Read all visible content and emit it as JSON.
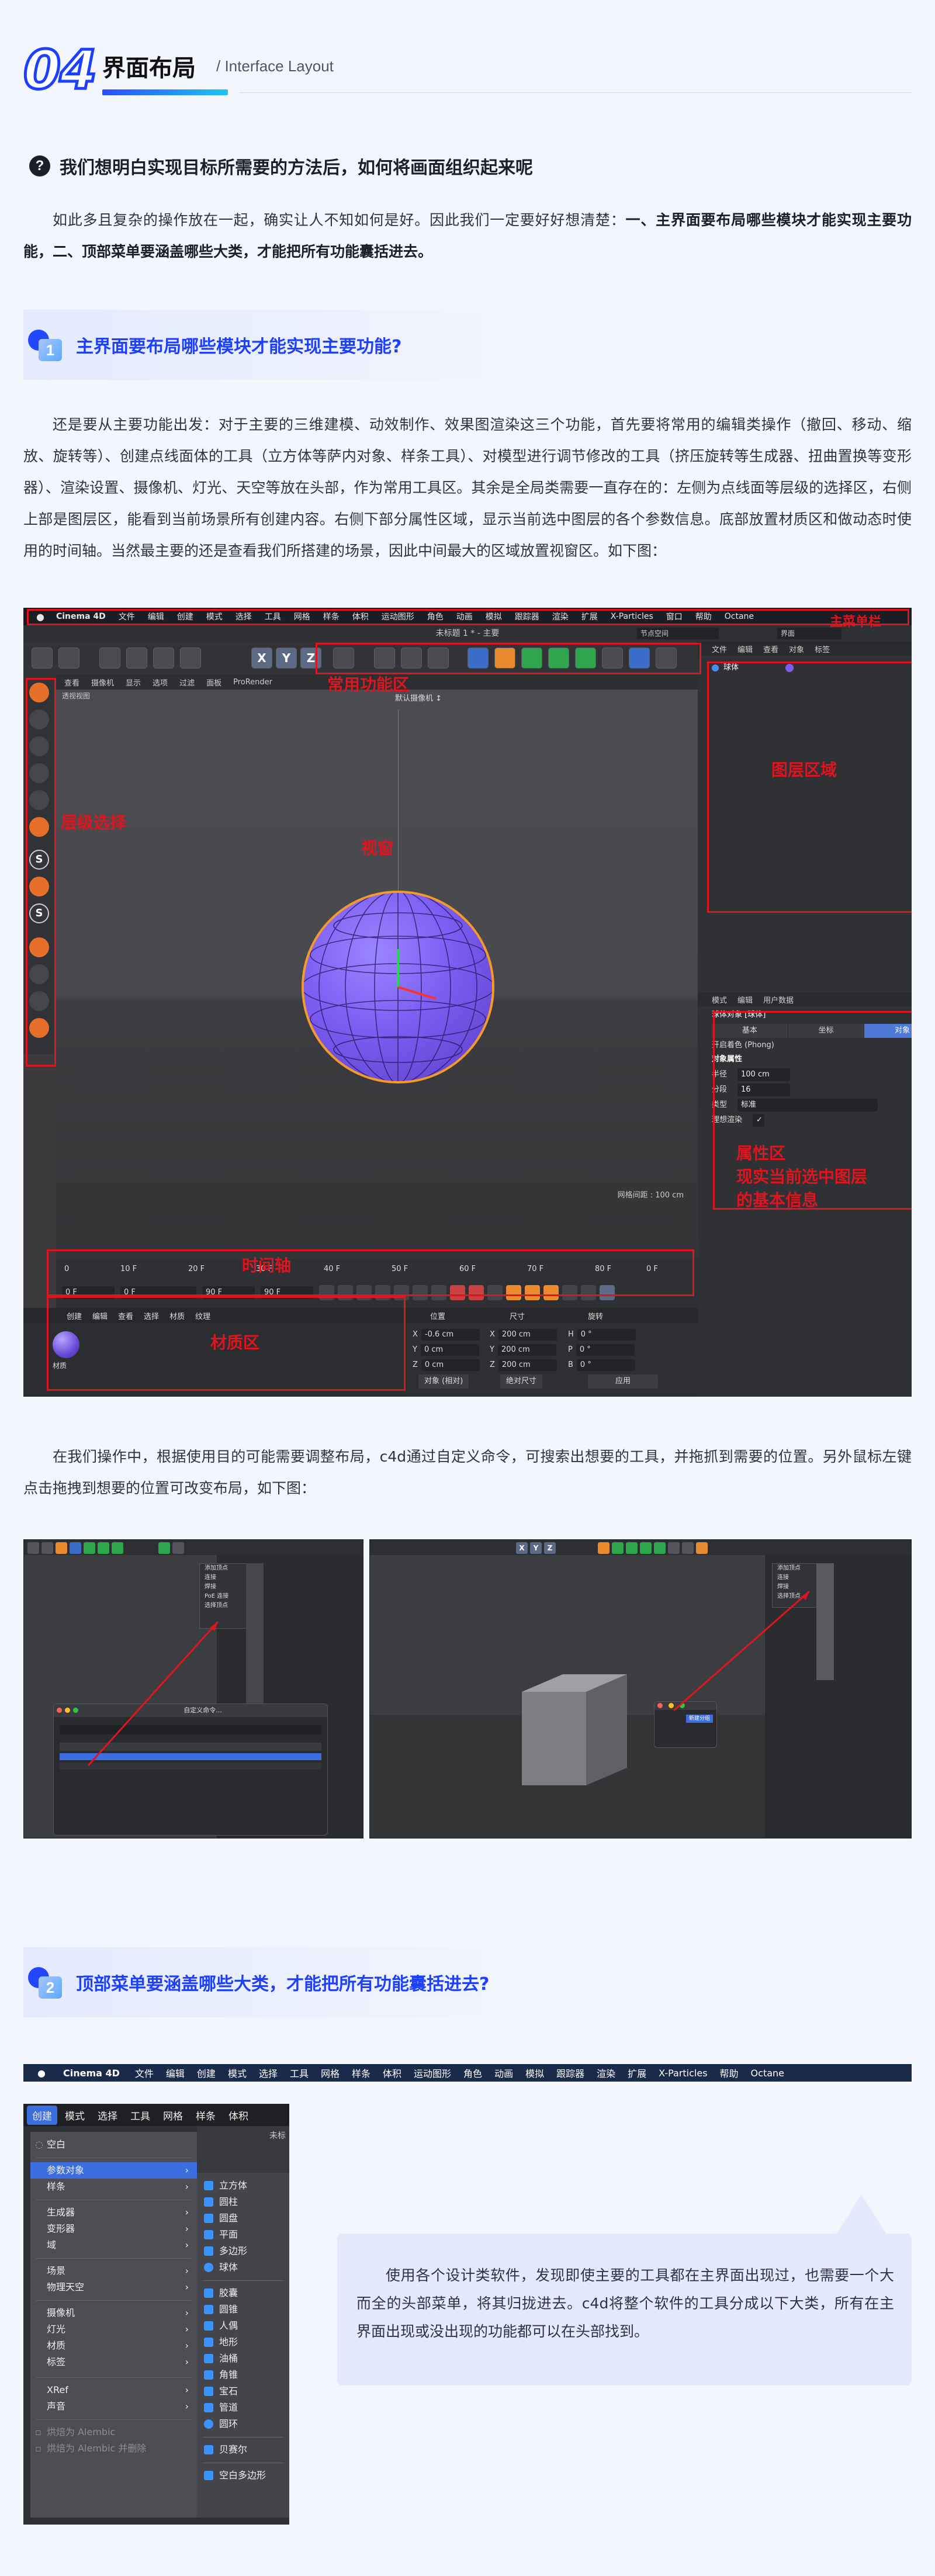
{
  "header": {
    "number": "04",
    "title": "界面布局",
    "subtitle": "/ Interface Layout"
  },
  "question": "我们想明白实现目标所需要的方法后，如何将画面组织起来呢",
  "intro": {
    "text": "如此多且复杂的操作放在一起，确实让人不知如何是好。因此我们一定要好好想清楚：",
    "bold": "一、主界面要布局哪些模块才能实现主要功能，二、顶部菜单要涵盖哪些大类，才能把所有功能囊括进去。"
  },
  "section1": {
    "num": "1",
    "title": "主界面要布局哪些模块才能实现主要功能?",
    "para": "还是要从主要功能出发：对于主要的三维建模、动效制作、效果图渲染这三个功能，首先要将常用的编辑类操作（撤回、移动、缩放、旋转等）、创建点线面体的工具（立方体等萨内对象、样条工具）、对模型进行调节修改的工具（挤压旋转等生成器、扭曲置换等变形器）、渲染设置、摄像机、灯光、天空等放在头部，作为常用工具区。其余是全局类需要一直存在的：左侧为点线面等层级的选择区，右侧上部是图层区，能看到当前场景所有创建内容。右侧下部分属性区域，显示当前选中图层的各个参数信息。底部放置材质区和做动态时使用的时间轴。当然最主要的还是查看我们所搭建的场景，因此中间最大的区域放置视窗区。如下图："
  },
  "screenshot1": {
    "mac_menu": [
      "Cinema 4D",
      "文件",
      "编辑",
      "创建",
      "模式",
      "选择",
      "工具",
      "网格",
      "样条",
      "体积",
      "运动图形",
      "角色",
      "动画",
      "模拟",
      "跟踪器",
      "渲染",
      "扩展",
      "X-Particles",
      "窗口",
      "帮助",
      "Octane"
    ],
    "doc_title": "未标题 1 * - 主要",
    "node_space": "节点空间",
    "layout_box": "界面",
    "viewport_menu": [
      "查看",
      "摄像机",
      "显示",
      "选项",
      "过滤",
      "面板",
      "ProRender"
    ],
    "viewport_name": "透视视图",
    "camera": "默认摄像机 ↕",
    "grid_text": "网格间距 : 100 cm",
    "obj_menu": [
      "文件",
      "编辑",
      "查看",
      "对象",
      "标签"
    ],
    "obj_item": "球体",
    "attr_menu": [
      "模式",
      "编辑",
      "用户数据"
    ],
    "attr_obj": "球体对象 [球体]",
    "attr_tabs": [
      "基本",
      "坐标",
      "对象"
    ],
    "attr_phong": "开启着色 (Phong)",
    "attr_section": "对象属性",
    "attr_fields": [
      {
        "label": "半径",
        "value": "100 cm"
      },
      {
        "label": "分段",
        "value": "16"
      },
      {
        "label": "类型",
        "value": "标准"
      },
      {
        "label": "理想渲染",
        "value": "✓"
      }
    ],
    "timeline_ticks": [
      "0",
      "10 F",
      "20 F",
      "30 F",
      "40 F",
      "50 F",
      "60 F",
      "70 F",
      "80 F",
      "90 F"
    ],
    "timeline_fields": [
      "0 F",
      "0 F",
      "90 F",
      "90 F"
    ],
    "timeline_end": "0 F",
    "mat_menu": [
      "创建",
      "编辑",
      "查看",
      "选择",
      "材质",
      "纹理"
    ],
    "mat_name": "材质",
    "coord_headers": [
      "位置",
      "尺寸",
      "旋转"
    ],
    "coord_rows": [
      {
        "axis": "X",
        "pos": "-0.6 cm",
        "size": "200 cm",
        "rot_axis": "H",
        "rot": "0 °"
      },
      {
        "axis": "Y",
        "pos": "0 cm",
        "size": "200 cm",
        "rot_axis": "P",
        "rot": "0 °"
      },
      {
        "axis": "Z",
        "pos": "0 cm",
        "size": "200 cm",
        "rot_axis": "B",
        "rot": "0 °"
      }
    ],
    "coord_buttons": [
      "对象 (相对)",
      "绝对尺寸",
      "应用"
    ],
    "labels": {
      "main_menu": "主菜单栏",
      "common_tools": "常用功能区",
      "layer_area": "图层区域",
      "mode_select": "层级选择",
      "viewport": "视窗",
      "attr_area": "属性区",
      "attr_desc_1": "现实当前选中图层",
      "attr_desc_2": "的基本信息",
      "timeline": "时间轴",
      "material": "材质区"
    },
    "colors": {
      "annotation": "#e0141e",
      "sphere": "#7b5df2"
    }
  },
  "para2": "在我们操作中，根据使用目的可能需要调整布局，c4d通过自定义命令，可搜索出想要的工具，并拖抓到需要的位置。另外鼠标左键点击拖拽到想要的位置可改变布局，如下图：",
  "small_shots": {
    "left_dialog_title": "自定义命令...",
    "left_menu": [
      "添加顶点",
      "连接",
      "焊接",
      "PoE 连接",
      "选择顶点"
    ],
    "right_menu": [
      "添加顶点",
      "连接",
      "焊接",
      "选择顶点"
    ],
    "right_badge": "新建分组"
  },
  "section2": {
    "num": "2",
    "title": "顶部菜单要涵盖哪些大类，才能把所有功能囊括进去?"
  },
  "menubar2": [
    "Cinema 4D",
    "文件",
    "编辑",
    "创建",
    "模式",
    "选择",
    "工具",
    "网格",
    "样条",
    "体积",
    "运动图形",
    "角色",
    "动画",
    "模拟",
    "跟踪器",
    "渲染",
    "扩展",
    "X-Particles",
    "帮助",
    "Octane"
  ],
  "menu_shot": {
    "bar": [
      "创建",
      "模式",
      "选择",
      "工具",
      "网格",
      "样条",
      "体积"
    ],
    "corner_text": "未标",
    "drop1": [
      "空白",
      "参数对象",
      "样条",
      "生成器",
      "变形器",
      "域",
      "场景",
      "物理天空",
      "摄像机",
      "灯光",
      "材质",
      "标签",
      "XRef",
      "声音",
      "烘焙为 Alembic",
      "烘焙为 Alembic 并删除"
    ],
    "drop2": [
      "立方体",
      "圆柱",
      "圆盘",
      "平面",
      "多边形",
      "球体",
      "胶囊",
      "圆锥",
      "人偶",
      "地形",
      "油桶",
      "角锥",
      "宝石",
      "管道",
      "圆环",
      "贝赛尔",
      "空白多边形"
    ]
  },
  "note": "使用各个设计类软件，发现即使主要的工具都在主界面出现过，也需要一个大而全的头部菜单，将其归拢进去。c4d将整个软件的工具分成以下大类，所有在主界面出现或没出现的功能都可以在头部找到。"
}
